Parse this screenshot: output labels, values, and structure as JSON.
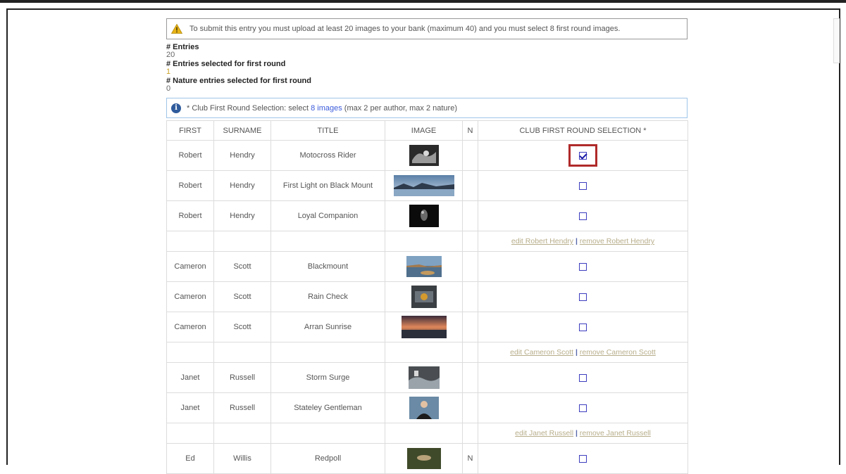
{
  "notice": {
    "text": "To submit this entry you must upload at least 20 images to your bank (maximum 40) and you must select 8 first round images."
  },
  "stats": [
    {
      "label": "# Entries",
      "value": "20"
    },
    {
      "label": "# Entries selected for first round",
      "value": "1"
    },
    {
      "label": "# Nature entries selected for first round",
      "value": "0"
    }
  ],
  "info": {
    "prefix": "* Club First Round Selection: select",
    "link": "8 images",
    "suffix": "(max 2 per author, max 2 nature)"
  },
  "table": {
    "headers": [
      "FIRST",
      "SURNAME",
      "TITLE",
      "IMAGE",
      "N",
      "CLUB FIRST ROUND SELECTION *"
    ],
    "rows": [
      {
        "first": "Robert",
        "surname": "Hendry",
        "title": "Motocross Rider",
        "n": "",
        "selected": true
      },
      {
        "first": "Robert",
        "surname": "Hendry",
        "title": "First Light on Black Mount",
        "n": "",
        "selected": false
      },
      {
        "first": "Robert",
        "surname": "Hendry",
        "title": "Loyal Companion",
        "n": "",
        "selected": false
      },
      {
        "edit": "edit Robert Hendry",
        "remove": "remove Robert Hendry"
      },
      {
        "first": "Cameron",
        "surname": "Scott",
        "title": "Blackmount",
        "n": "",
        "selected": false
      },
      {
        "first": "Cameron",
        "surname": "Scott",
        "title": "Rain Check",
        "n": "",
        "selected": false
      },
      {
        "first": "Cameron",
        "surname": "Scott",
        "title": "Arran Sunrise",
        "n": "",
        "selected": false
      },
      {
        "edit": "edit Cameron Scott",
        "remove": "remove Cameron Scott"
      },
      {
        "first": "Janet",
        "surname": "Russell",
        "title": "Storm Surge",
        "n": "",
        "selected": false
      },
      {
        "first": "Janet",
        "surname": "Russell",
        "title": "Stateley Gentleman",
        "n": "",
        "selected": false
      },
      {
        "edit": "edit Janet Russell",
        "remove": "remove Janet Russell"
      },
      {
        "first": "Ed",
        "surname": "Willis",
        "title": "Redpoll",
        "n": "N",
        "selected": false
      }
    ]
  },
  "colors": {
    "highlight": "#b02a2a",
    "checkbox": "#3d3dbf",
    "info_border": "#9fc5e8",
    "link": "#3b5bdb"
  }
}
